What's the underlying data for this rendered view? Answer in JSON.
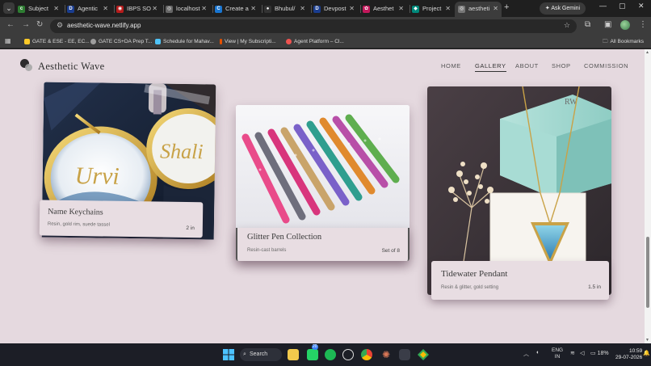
{
  "browser": {
    "tabs": [
      {
        "label": "Subject",
        "fav_color": "#2e7d32",
        "fav_glyph": "c"
      },
      {
        "label": "Agentic",
        "fav_color": "#1a3d8f",
        "fav_glyph": "D"
      },
      {
        "label": "IBPS SO",
        "fav_color": "#b71c1c",
        "fav_glyph": "◉"
      },
      {
        "label": "localhost",
        "fav_color": "#666666",
        "fav_glyph": "◎"
      },
      {
        "label": "Create a",
        "fav_color": "#1976d2",
        "fav_glyph": "C"
      },
      {
        "label": "Bhubul/",
        "fav_color": "#333333",
        "fav_glyph": "●"
      },
      {
        "label": "Devpost",
        "fav_color": "#1a3d8f",
        "fav_glyph": "D"
      },
      {
        "label": "Aesthet",
        "fav_color": "#c2185b",
        "fav_glyph": "✿"
      },
      {
        "label": "Project",
        "fav_color": "#00897b",
        "fav_glyph": "◆"
      },
      {
        "label": "aestheti",
        "fav_color": "#777777",
        "fav_glyph": "◎"
      }
    ],
    "active_tab_index": 9,
    "new_tab_label": "+",
    "gemini_label": "Ask Gemini",
    "url": "aesthetic-wave.netlify.app",
    "window_controls": [
      "⌄",
      "—",
      "▢",
      "✕"
    ]
  },
  "bookmarks": {
    "items": [
      {
        "label": "GATE & ESE - EE, EC...",
        "fav_color": "#ffca28"
      },
      {
        "label": "GATE CS+DA Prep T...",
        "fav_color": "#9e9e9e"
      },
      {
        "label": "Schedule for Mahav...",
        "fav_color": "#4fc3f7"
      },
      {
        "label": "View | My Subscripti...",
        "fav_color": "#e65100"
      },
      {
        "label": "Agent Platform – Cl...",
        "fav_color": "#ef5350"
      }
    ],
    "all_bookmarks_label": "All Bookmarks"
  },
  "site": {
    "brand": "Aesthetic Wave",
    "nav": [
      {
        "label": "HOME",
        "active": false
      },
      {
        "label": "GALLERY",
        "active": true
      },
      {
        "label": "ABOUT",
        "active": false
      },
      {
        "label": "SHOP",
        "active": false
      },
      {
        "label": "COMMISSION",
        "active": false
      }
    ]
  },
  "cards": [
    {
      "title": "Name Keychains",
      "subtitle": "Resin, gold rim, suede tassel",
      "meta": "2 in",
      "img_names": [
        "Urvi",
        "Shali"
      ]
    },
    {
      "title": "Glitter Pen Collection",
      "subtitle": "Resin-cast barrels",
      "meta": "Set of 8"
    },
    {
      "title": "Tidewater Pendant",
      "subtitle": "Resin & glitter, gold setting",
      "meta": "1.5 in",
      "box_text": "RW"
    }
  ],
  "taskbar": {
    "search_label": "Search",
    "whatsapp_badge": "20",
    "lang_line1": "ENG",
    "lang_line2": "IN",
    "battery": "18%",
    "time": "10:59",
    "date": "29-07-2026"
  }
}
